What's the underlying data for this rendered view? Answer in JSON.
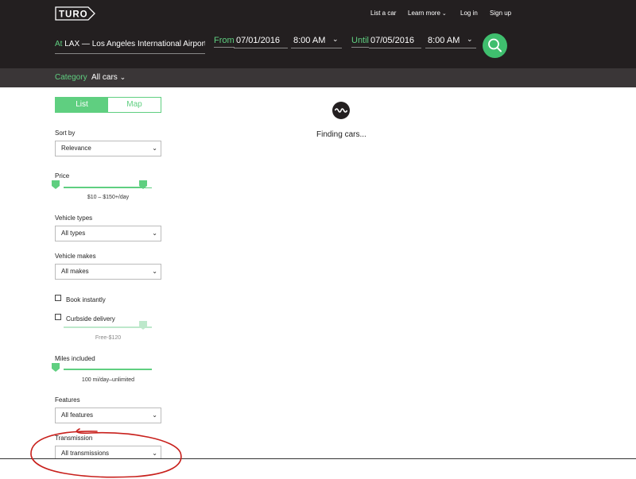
{
  "brand": {
    "logo_text": "TURO"
  },
  "nav": {
    "list_car": "List a car",
    "learn_more": "Learn more",
    "log_in": "Log in",
    "sign_up": "Sign up"
  },
  "search": {
    "at_label": "At",
    "location": "LAX — Los Angeles International Airport, Lo",
    "from_label": "From",
    "from_date": "07/01/2016",
    "from_time": "8:00 AM",
    "until_label": "Until",
    "until_date": "07/05/2016",
    "until_time": "8:00 AM"
  },
  "category": {
    "label": "Category",
    "value": "All cars"
  },
  "view_toggle": {
    "list": "List",
    "map": "Map"
  },
  "filters": {
    "sort_by_label": "Sort by",
    "sort_by_value": "Relevance",
    "price_label": "Price",
    "price_range": "$10 – $150+/day",
    "vehicle_types_label": "Vehicle types",
    "vehicle_types_value": "All types",
    "vehicle_makes_label": "Vehicle makes",
    "vehicle_makes_value": "All makes",
    "book_instantly": "Book instantly",
    "curbside_delivery": "Curbside delivery",
    "curbside_range": "Free-$120",
    "miles_label": "Miles included",
    "miles_range": "100 mi/day–unlimited",
    "features_label": "Features",
    "features_value": "All features",
    "transmission_label": "Transmission",
    "transmission_value": "All transmissions"
  },
  "status": {
    "finding": "Finding cars..."
  },
  "colors": {
    "accent": "#5fcf80",
    "header_bg": "#231f20",
    "subbar_bg": "#3a3637",
    "annotation": "#c8201c"
  }
}
